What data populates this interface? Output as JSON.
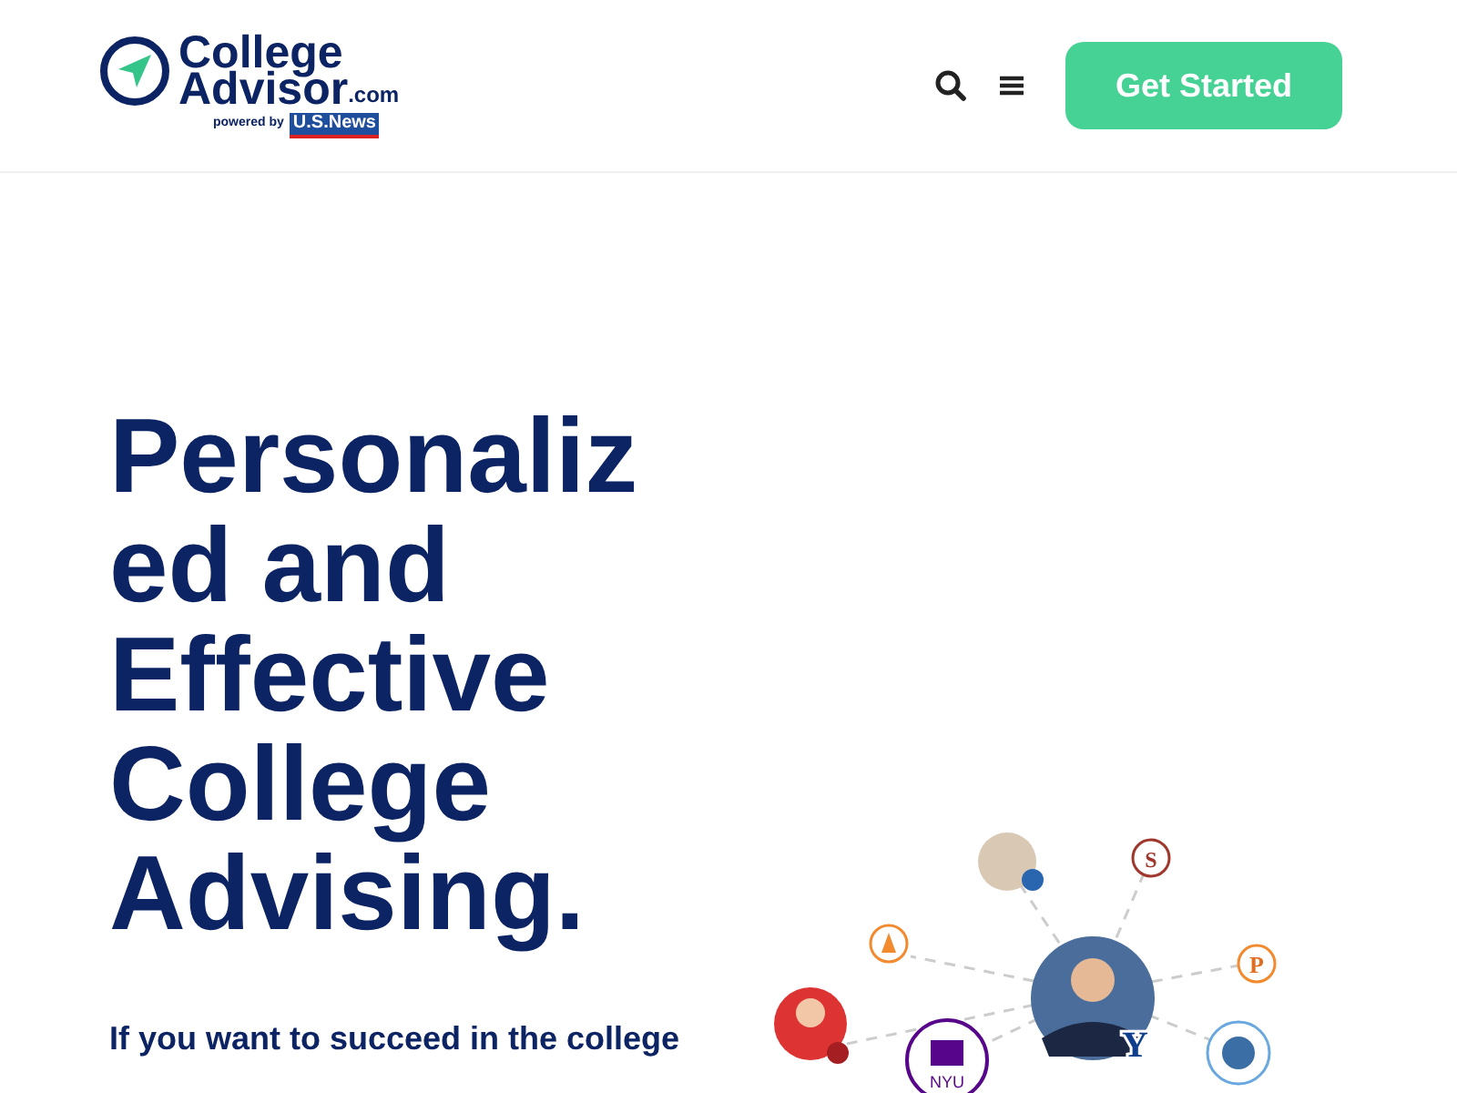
{
  "header": {
    "logo": {
      "line_1": "College",
      "line_2": "Advisor",
      "suffix": ".com",
      "powered_by": "powered by",
      "partner": "U.S.News"
    },
    "cta": "Get Started"
  },
  "hero": {
    "headline": "Personalized and Effective College Advising.",
    "intro": "If you want to succeed in the college"
  },
  "network": {
    "center_badge": "Y",
    "school_badges": [
      "S",
      "P"
    ],
    "nyu_label": "NYU"
  }
}
